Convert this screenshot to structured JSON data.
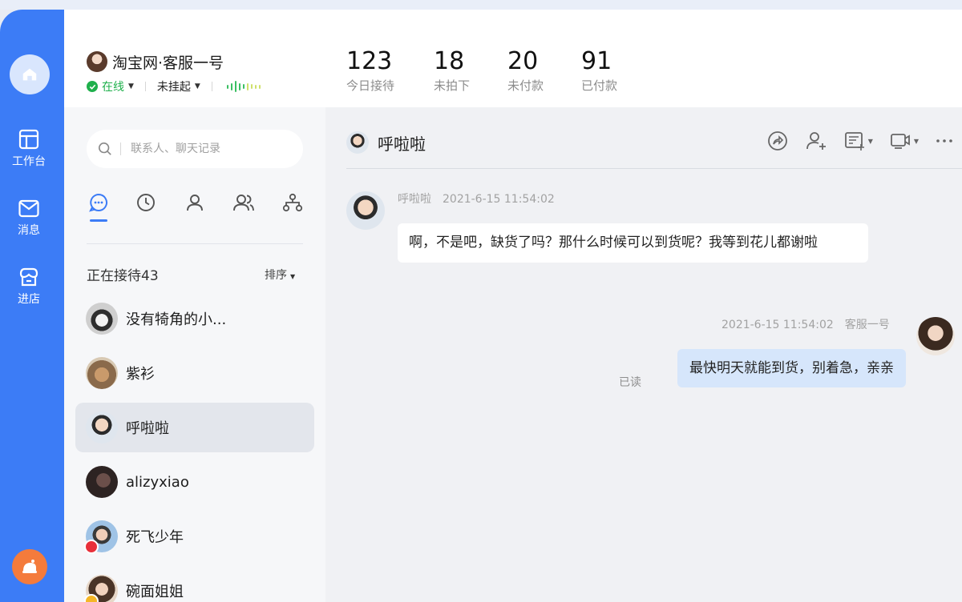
{
  "nav": {
    "items": [
      {
        "label": "工作台",
        "icon": "workbench-icon"
      },
      {
        "label": "消息",
        "icon": "message-icon"
      },
      {
        "label": "进店",
        "icon": "store-icon"
      }
    ]
  },
  "account": {
    "name": "淘宝网·客服一号",
    "status": "在线",
    "hang_status": "未挂起"
  },
  "stats": [
    {
      "value": "123",
      "label": "今日接待"
    },
    {
      "value": "18",
      "label": "未拍下"
    },
    {
      "value": "20",
      "label": "未付款"
    },
    {
      "value": "91",
      "label": "已付款"
    }
  ],
  "search": {
    "placeholder": "联系人、聊天记录"
  },
  "contacts": {
    "section_title": "正在接待43",
    "sort_label": "排序",
    "list": [
      {
        "name": "没有犄角的小..."
      },
      {
        "name": "紫衫"
      },
      {
        "name": "呼啦啦"
      },
      {
        "name": "alizyxiao"
      },
      {
        "name": "死飞少年"
      },
      {
        "name": "碗面姐姐"
      }
    ]
  },
  "chat": {
    "title": "呼啦啦",
    "messages": [
      {
        "sender": "呼啦啦",
        "time": "2021-6-15 11:54:02",
        "text": "啊，不是吧，缺货了吗？那什么时候可以到货呢？我等到花儿都谢啦"
      },
      {
        "sender": "客服一号",
        "time": "2021-6-15 11:54:02",
        "text": "最快明天就能到货，别着急，亲亲",
        "status": "已读"
      }
    ]
  },
  "colors": {
    "brand_blue": "#3c7cf6",
    "online_green": "#1fb04c",
    "outgoing_bubble": "#d6e6fb"
  }
}
